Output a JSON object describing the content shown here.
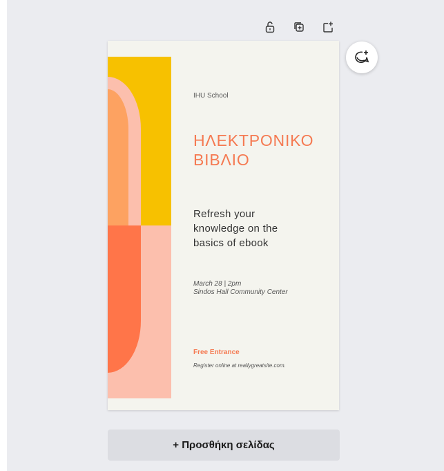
{
  "toolbar": {
    "icons": [
      "unlock-icon",
      "duplicate-page-icon",
      "add-page-icon"
    ]
  },
  "page": {
    "school": "IHU School",
    "title_line1": "ΗΛΕΚΤΡΟΝΙΚΟ",
    "title_line2": "ΒΙΒΛΙΟ",
    "description_line1": "Refresh your",
    "description_line2": "knowledge on the",
    "description_line3": "basics of ebook",
    "date_line": "March 28  | 2pm",
    "location_line": "Sindos Hall Community Center",
    "entrance": "Free Entrance",
    "register": "Register online at reallygreatsite.com."
  },
  "comment_button": {
    "icon": "add-comment-icon"
  },
  "add_page_button": {
    "label": "+ Προσθήκη σελίδας"
  },
  "colors": {
    "canvas_bg": "#ebecf0",
    "page_bg": "#f4f4ee",
    "accent_orange": "#f57a52",
    "yellow": "#f7c100",
    "peach": "#fcbfad",
    "light_orange": "#fda261",
    "deep_orange": "#ff7549"
  }
}
